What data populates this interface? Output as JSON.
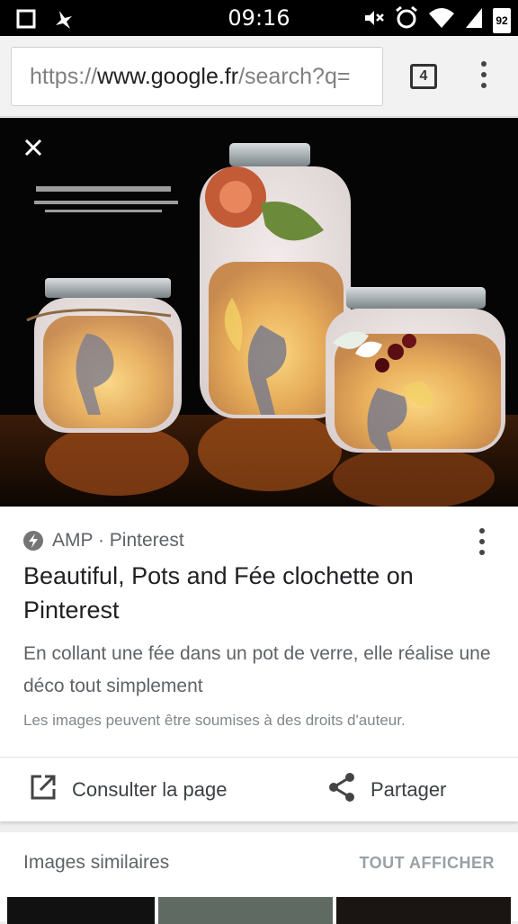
{
  "status_bar": {
    "time": "09:16",
    "battery": "92"
  },
  "browser": {
    "url_scheme": "https://",
    "url_host": "www.google.fr",
    "url_rest": "/search?q=",
    "tab_count": "4"
  },
  "result": {
    "source": "AMP · Pinterest",
    "title": "Beautiful, Pots and Fée clochette on Pinterest",
    "description": "En collant une fée dans un pot de verre, elle réalise une déco tout simplement",
    "copyright": "Les images peuvent être soumises à des droits d'auteur.",
    "open_label": "Consulter la page",
    "share_label": "Partager"
  },
  "similar": {
    "title": "Images similaires",
    "show_all": "TOUT AFFICHER"
  },
  "colors": {
    "accent_text": "#202124",
    "secondary_text": "#5f6368"
  }
}
